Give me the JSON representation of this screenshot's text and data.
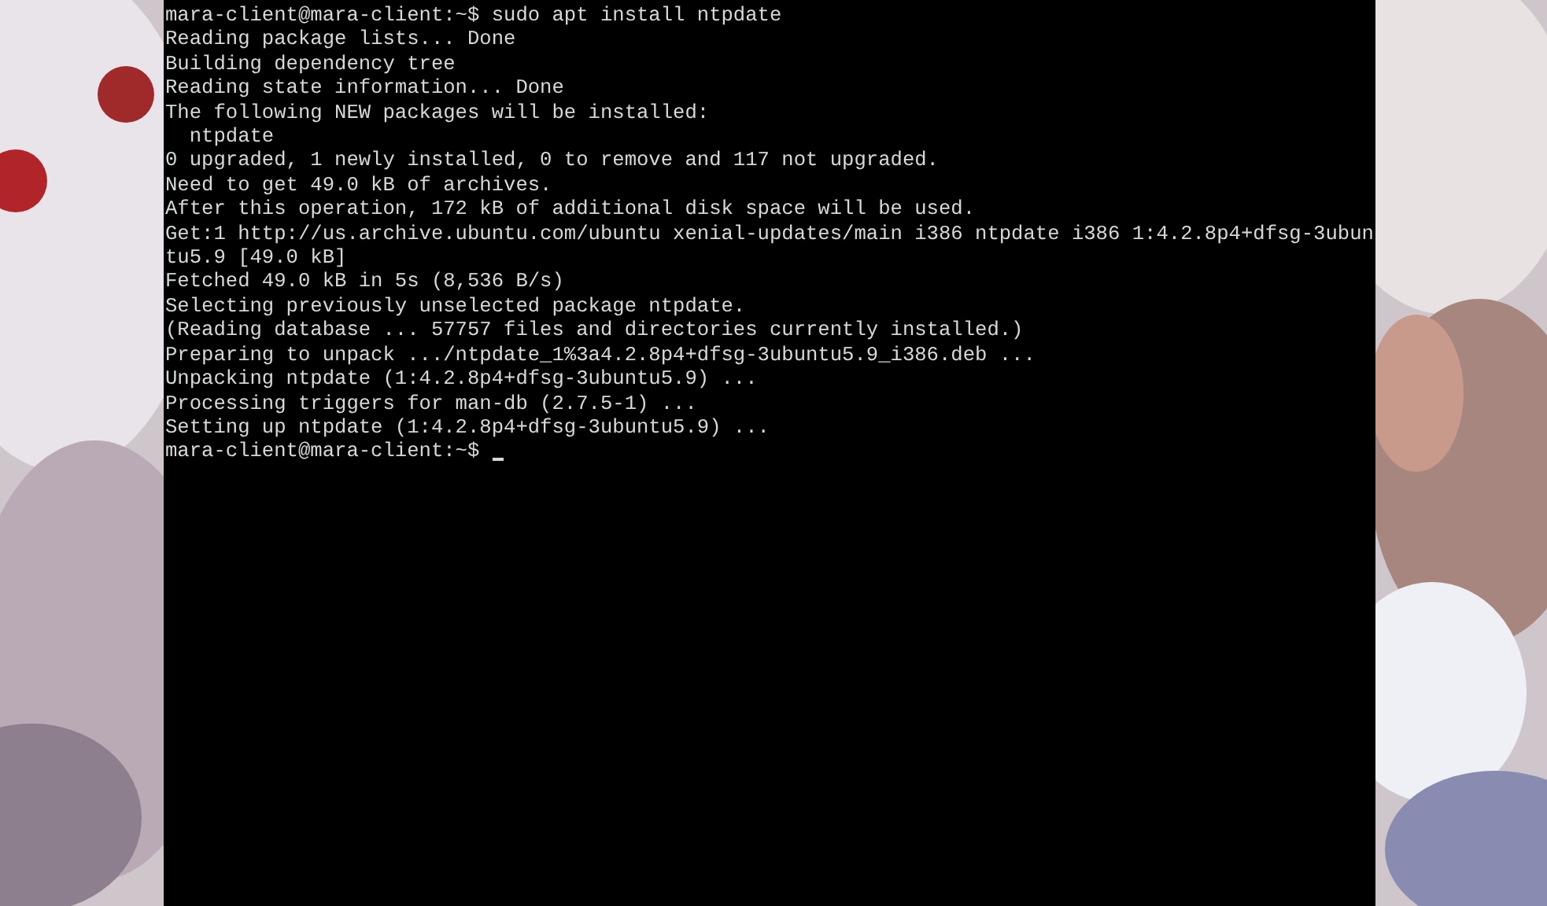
{
  "terminal": {
    "lines": [
      "mara-client@mara-client:~$ sudo apt install ntpdate",
      "Reading package lists... Done",
      "Building dependency tree",
      "Reading state information... Done",
      "The following NEW packages will be installed:",
      "  ntpdate",
      "0 upgraded, 1 newly installed, 0 to remove and 117 not upgraded.",
      "Need to get 49.0 kB of archives.",
      "After this operation, 172 kB of additional disk space will be used.",
      "Get:1 http://us.archive.ubuntu.com/ubuntu xenial-updates/main i386 ntpdate i386 1:4.2.8p4+dfsg-3ubun",
      "tu5.9 [49.0 kB]",
      "Fetched 49.0 kB in 5s (8,536 B/s)",
      "Selecting previously unselected package ntpdate.",
      "(Reading database ... 57757 files and directories currently installed.)",
      "Preparing to unpack .../ntpdate_1%3a4.2.8p4+dfsg-3ubuntu5.9_i386.deb ...",
      "Unpacking ntpdate (1:4.2.8p4+dfsg-3ubuntu5.9) ...",
      "Processing triggers for man-db (2.7.5-1) ...",
      "Setting up ntpdate (1:4.2.8p4+dfsg-3ubuntu5.9) ..."
    ],
    "prompt": "mara-client@mara-client:~$",
    "cursor_visible": true
  }
}
